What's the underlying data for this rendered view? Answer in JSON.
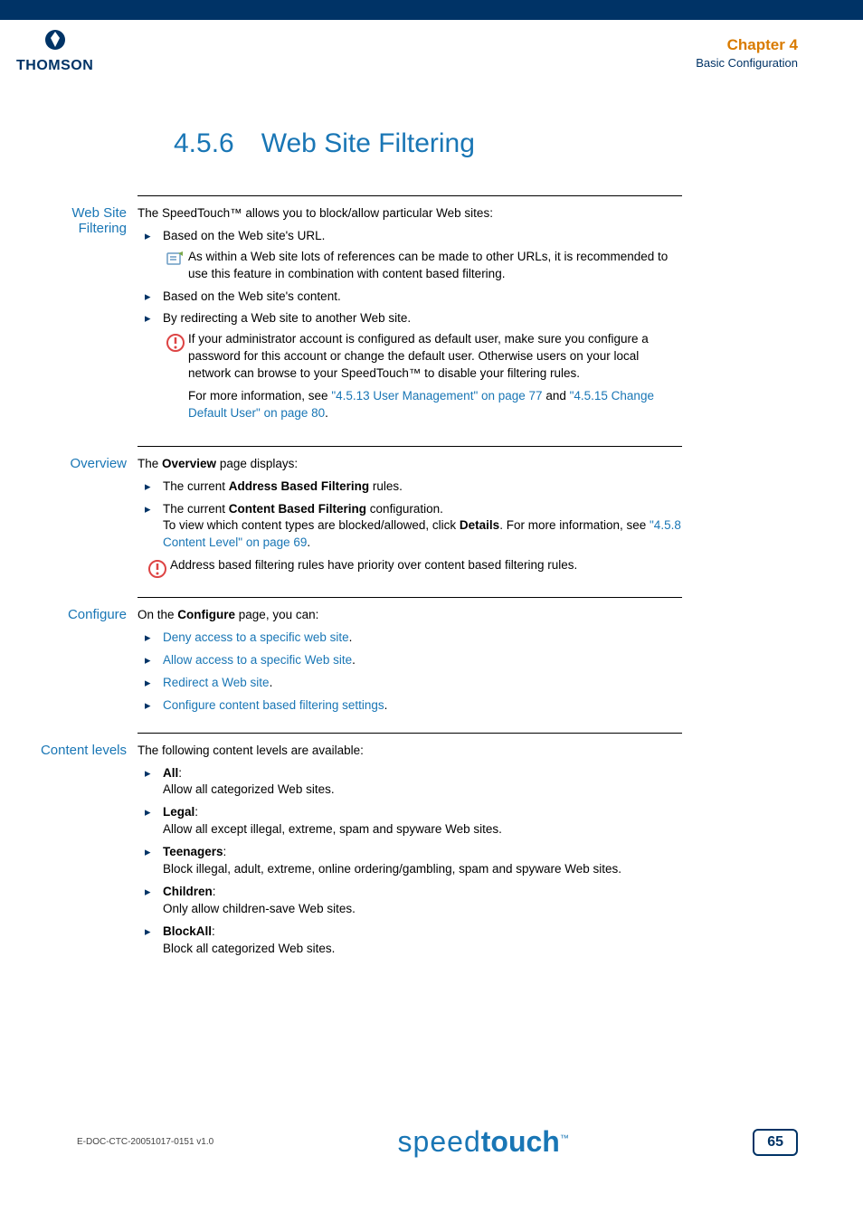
{
  "header": {
    "logo_text": "THOMSON",
    "chapter": "Chapter 4",
    "chapter_sub": "Basic Configuration"
  },
  "title": "4.5.6 Web Site Filtering",
  "sections": {
    "wsf": {
      "heading": "Web Site Filtering",
      "intro": "The SpeedTouch™ allows you to block/allow particular Web sites:",
      "b1": "Based on the Web site's URL.",
      "note1": "As within a Web site lots of references can be made to other URLs, it is recommended to use this feature in combination with content based filtering.",
      "b2": "Based on the Web site's content.",
      "b3": "By redirecting a Web site to another Web site.",
      "warn1": "If your administrator account is configured as default user, make sure you configure a password for this account or change the default user. Otherwise users on your local network can browse to your SpeedTouch™ to disable your filtering rules.",
      "warn1b_pre": "For more information, see ",
      "warn1b_link1": "\"4.5.13 User Management\" on page 77",
      "warn1b_mid": " and ",
      "warn1b_link2": "\"4.5.15 Change Default User\" on page 80",
      "warn1b_post": "."
    },
    "overview": {
      "heading": "Overview",
      "intro_pre": "The ",
      "intro_bold": "Overview",
      "intro_post": " page displays:",
      "b1_pre": "The current ",
      "b1_bold": "Address Based Filtering",
      "b1_post": " rules.",
      "b2_pre": "The current ",
      "b2_bold": "Content Based Filtering",
      "b2_post": " configuration.",
      "b2_line2_pre": "To view which content types are blocked/allowed, click ",
      "b2_line2_bold": "Details",
      "b2_line2_post": ". For more information, see ",
      "b2_line2_link": "\"4.5.8 Content Level\" on page 69",
      "b2_line2_end": ".",
      "warn": "Address based filtering rules have priority over content based filtering rules."
    },
    "configure": {
      "heading": "Configure",
      "intro_pre": "On the ",
      "intro_bold": "Configure",
      "intro_post": " page, you can:",
      "b1": "Deny access to a specific web site",
      "b2": "Allow access to a specific Web site",
      "b3": "Redirect a Web site",
      "b4": "Configure content based filtering settings"
    },
    "levels": {
      "heading": "Content levels",
      "intro": "The following content levels are available:",
      "l1_name": "All",
      "l1_desc": "Allow all categorized Web sites.",
      "l2_name": "Legal",
      "l2_desc": "Allow all except illegal, extreme, spam and spyware Web sites.",
      "l3_name": "Teenagers",
      "l3_desc": "Block illegal, adult, extreme, online ordering/gambling, spam and spyware Web sites.",
      "l4_name": "Children",
      "l4_desc": "Only allow children-save Web sites.",
      "l5_name": "BlockAll",
      "l5_desc": "Block all categorized Web sites."
    }
  },
  "footer": {
    "doc_id": "E-DOC-CTC-20051017-0151 v1.0",
    "brand_light": "speed",
    "brand_bold": "touch",
    "brand_tm": "™",
    "page": "65"
  }
}
